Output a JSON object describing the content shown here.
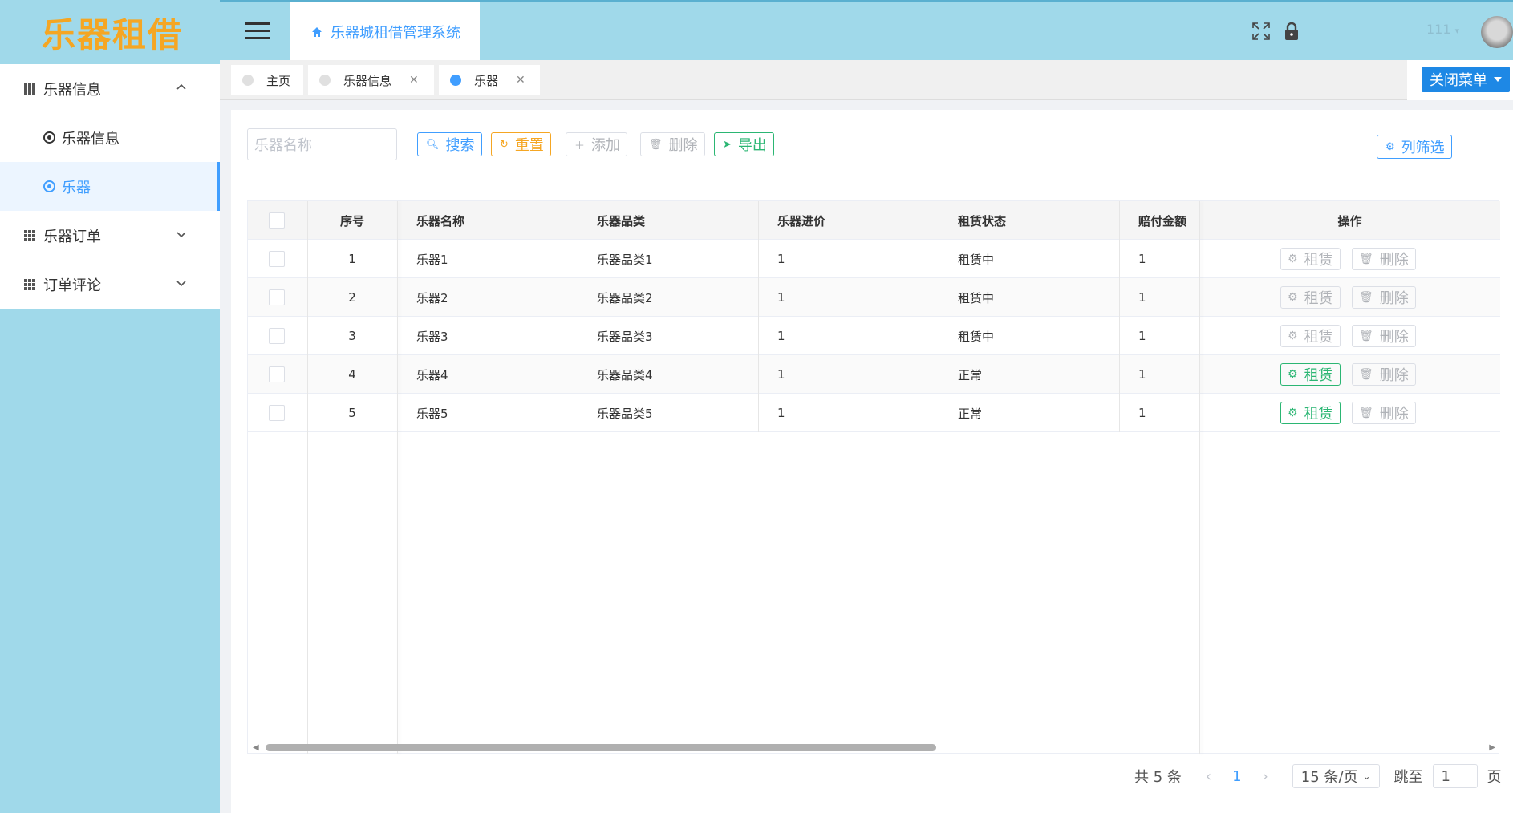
{
  "brand": {
    "logo_text": "乐器租借",
    "logo_color": "#f5a623"
  },
  "sidebar": {
    "groups": [
      {
        "label": "乐器信息",
        "expanded": true,
        "children": [
          {
            "label": "乐器信息",
            "active": false
          },
          {
            "label": "乐器",
            "active": true
          }
        ]
      },
      {
        "label": "乐器订单",
        "expanded": false
      },
      {
        "label": "订单评论",
        "expanded": false
      }
    ]
  },
  "header": {
    "main_tab": "乐器城租借管理系统",
    "user": "111",
    "icons": [
      "fullscreen-icon",
      "lock-icon"
    ]
  },
  "tabs": [
    {
      "label": "主页",
      "closable": false,
      "active": false
    },
    {
      "label": "乐器信息",
      "closable": true,
      "active": false
    },
    {
      "label": "乐器",
      "closable": true,
      "active": true
    }
  ],
  "close_menu_label": "关闭菜单",
  "toolbar": {
    "search_placeholder": "乐器名称",
    "search": "搜索",
    "reset": "重置",
    "add": "添加",
    "delete": "删除",
    "export": "导出",
    "column_filter": "列筛选"
  },
  "table": {
    "columns": [
      "序号",
      "乐器名称",
      "乐器品类",
      "乐器进价",
      "租赁状态",
      "赔付金额",
      "操作"
    ],
    "rows": [
      {
        "no": "1",
        "name": "乐器1",
        "category": "乐器品类1",
        "price": "1",
        "status": "租赁中",
        "compensation": "1",
        "rent_enabled": false
      },
      {
        "no": "2",
        "name": "乐器2",
        "category": "乐器品类2",
        "price": "1",
        "status": "租赁中",
        "compensation": "1",
        "rent_enabled": false
      },
      {
        "no": "3",
        "name": "乐器3",
        "category": "乐器品类3",
        "price": "1",
        "status": "租赁中",
        "compensation": "1",
        "rent_enabled": false
      },
      {
        "no": "4",
        "name": "乐器4",
        "category": "乐器品类4",
        "price": "1",
        "status": "正常",
        "compensation": "1",
        "rent_enabled": true
      },
      {
        "no": "5",
        "name": "乐器5",
        "category": "乐器品类5",
        "price": "1",
        "status": "正常",
        "compensation": "1",
        "rent_enabled": true
      }
    ],
    "row_actions": {
      "rent": "租赁",
      "delete": "删除"
    }
  },
  "pagination": {
    "total": "共 5 条",
    "current_page": "1",
    "page_size": "15 条/页",
    "jump_label": "跳至",
    "jump_value": "1",
    "page_suffix": "页"
  }
}
